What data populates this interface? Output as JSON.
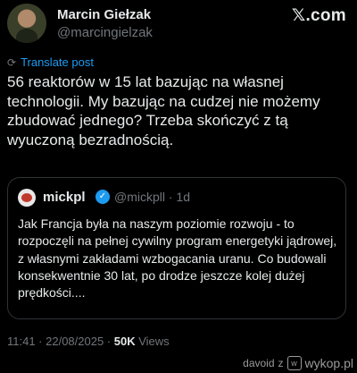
{
  "author": {
    "name": "Marcin Giełzak",
    "handle": "@marcingielzak"
  },
  "platform_logo": "𝕏.com",
  "translate_label": "Translate post",
  "tweet_text": "56 reaktorów w 15 lat bazując na własnej technologii. My bazując na cudzej nie możemy zbudować jednego? Trzeba skończyć z tą wyuczoną bezradnością.",
  "quote": {
    "name": "mickpl",
    "handle_time": "@mickpll · 1d",
    "text": "Jak Francja była na naszym poziomie rozwoju - to rozpoczęli na pełnej cywilny program energetyki jądrowej, z własnymi zakładami wzbogacania uranu. Co budowali konsekwentnie 30 lat, po drodze jeszcze kolej dużej prędkości...."
  },
  "meta": {
    "timestamp": "11:41 · 22/08/2025 · ",
    "views_count": "50K",
    "views_label": "Views"
  },
  "watermark": {
    "user": "davoid",
    "via": "z",
    "site": "wykop.pl"
  },
  "icons": {
    "translate": "translate-icon",
    "verified": "verified-badge-icon",
    "logo": "x-logo-icon",
    "wykop": "wykop-icon"
  }
}
